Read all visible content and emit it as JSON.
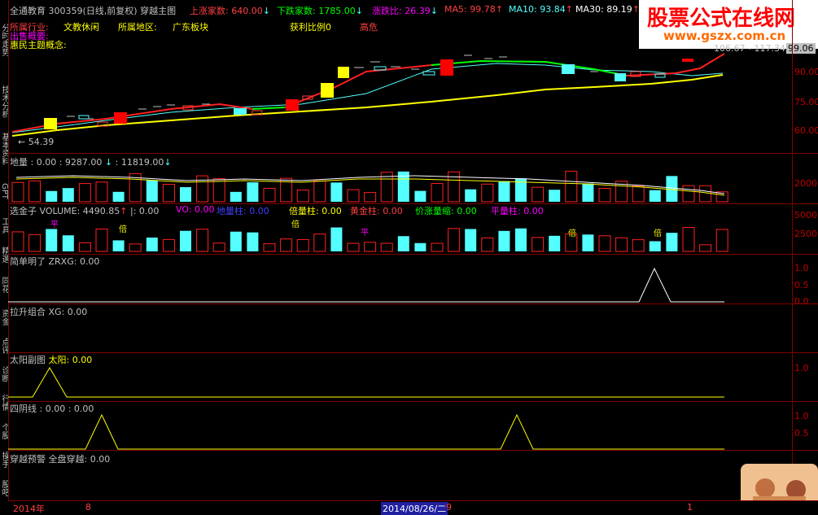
{
  "header": {
    "stock": "全通教育 300359(日线,前复权) 穿越主图",
    "up_label": "上涨家数: 640.00",
    "down_label": "下跌家数: 1785.00",
    "ratio_label": "涨跌比: 26.39",
    "ma5_label": "MA5: 99.78",
    "ma10_label": "MA10: 93.84",
    "ma30_label": "MA30: 89.19",
    "arrow_down": "↓",
    "arrow_up": "↑"
  },
  "info": {
    "industry_label": "所属行业:",
    "industry_value": "文教休闲",
    "region_label": "所属地区:",
    "region_value": "广东板块",
    "profit_label": "获利比例0",
    "risk_label": "高危",
    "line2_label": "出售概要:",
    "concept_label": "惠民主题概念:",
    "price_range": "106.67 - 117.34",
    "current_price": "99.06",
    "low_label": "54.39"
  },
  "watermark": {
    "title": "股票公式在线网",
    "url": "www.gszx.com.cn"
  },
  "sidebar": {
    "tabs": [
      "分时走势",
      "技术分析",
      "基本资料",
      "GPT",
      "工具",
      "精選",
      "同花",
      "资金",
      "点评",
      "诊断",
      "行情",
      "个股",
      "操手",
      "股吧"
    ]
  },
  "price_axis": {
    "ticks": [
      "90.00",
      "75.00",
      "60.00"
    ]
  },
  "volume_panel": {
    "title": "地量",
    "v1": ": 0.00",
    "v2": ": 9287.00",
    "v3": ": 11819.00",
    "tick": "2000"
  },
  "xuanjin_panel": {
    "title": "选金子",
    "volume": "VOLUME: 4490.85",
    "i_label": "|: 0.00",
    "vo_label": "VO: 0.00",
    "diliang_label": "地量柱: 0.00",
    "beiliang_label": "倍量柱: 0.00",
    "huangjin_label": "黄金柱: 0.00",
    "jiazhang_label": "价涨量缩: 0.00",
    "pingliang_label": "平量柱: 0.00",
    "ticks": [
      "5000",
      "2500"
    ],
    "marks": [
      "平",
      "倍",
      "倍",
      "平",
      "倍",
      "倍"
    ]
  },
  "panels": [
    {
      "title": "简单明了",
      "value": "ZRXG: 0.00",
      "ticks": [
        "1.0",
        "0.5",
        "0.0"
      ]
    },
    {
      "title": "拉升组合",
      "value": "XG: 0.00",
      "ticks": []
    },
    {
      "title": "太阳副图",
      "value": "太阳: 0.00",
      "ticks": [
        "1.0"
      ]
    },
    {
      "title": "四阴线",
      "value": ": 0.00  : 0.00",
      "ticks": [
        "1.0",
        "0.5"
      ]
    },
    {
      "title": "穿越预警",
      "value": "全盘穿越: 0.00",
      "ticks": []
    }
  ],
  "footer": {
    "year": "2014年",
    "month1": "8",
    "date": "2014/08/26/二",
    "month2": "9",
    "month3": "1"
  },
  "colors": {
    "up": "#ff0000",
    "down": "#54ffff",
    "yellow": "#ffff00",
    "border": "#800000",
    "magenta": "#ff00ff",
    "green": "#00ff00"
  }
}
